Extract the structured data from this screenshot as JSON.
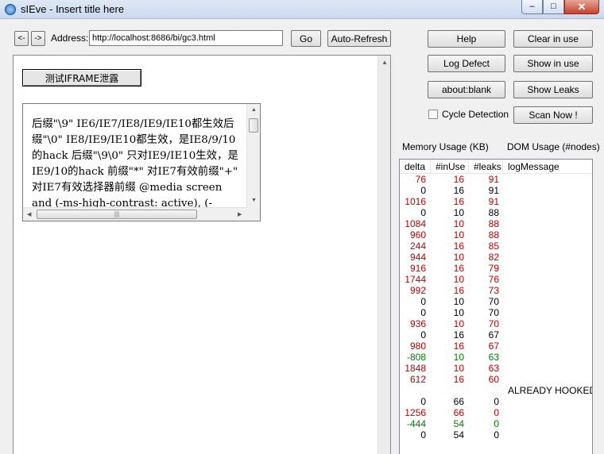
{
  "window": {
    "title": "sIEve - Insert title here",
    "controls": {
      "minimize": "–",
      "maximize": "□",
      "close": "✕"
    }
  },
  "toolbar": {
    "back": "<-",
    "forward": "->",
    "address_label": "Address:",
    "address_value": "http://localhost:8686/bi/gc3.html",
    "go": "Go",
    "auto_refresh": "Auto-Refresh"
  },
  "actions": {
    "help": "Help",
    "clear_in_use": "Clear in use",
    "log_defect": "Log Defect",
    "show_in_use": "Show in use",
    "about_blank": "about:blank",
    "show_leaks": "Show Leaks",
    "cycle_detection": "Cycle Detection",
    "scan_now": "Scan Now !"
  },
  "page": {
    "iframe_button": "测试IFRAME泄露",
    "textarea_text": "后缀\"\\9\" IE6/IE7/IE8/IE9/IE10都生效后缀\"\\0\" IE8/IE9/IE10都生效，是IE8/9/10的hack 后缀\"\\9\\0\" 只对IE9/IE10生效，是IE9/10的hack 前缀\"*\" 对IE7有效前缀\"+\" 对IE7有效选择器前缀 @media screen and (-ms-high-contrast: active), (-"
  },
  "usage": {
    "memory_label": "Memory Usage (KB)",
    "dom_label": "DOM Usage (#nodes)"
  },
  "colors": {
    "increase": "#c00000",
    "decrease": "#008000",
    "neutral": "#000000"
  },
  "table": {
    "columns": [
      "delta",
      "#inUse",
      "#leaks",
      "logMessage"
    ],
    "rows": [
      {
        "delta": "76",
        "inUse": "16",
        "leaks": "91",
        "msg": "",
        "c": [
          "red",
          "red",
          "red"
        ]
      },
      {
        "delta": "0",
        "inUse": "16",
        "leaks": "91",
        "msg": "",
        "c": [
          "black",
          "black",
          "black"
        ]
      },
      {
        "delta": "1016",
        "inUse": "16",
        "leaks": "91",
        "msg": "",
        "c": [
          "red",
          "red",
          "red"
        ]
      },
      {
        "delta": "0",
        "inUse": "10",
        "leaks": "88",
        "msg": "",
        "c": [
          "black",
          "black",
          "black"
        ]
      },
      {
        "delta": "1084",
        "inUse": "10",
        "leaks": "88",
        "msg": "",
        "c": [
          "red",
          "red",
          "red"
        ]
      },
      {
        "delta": "960",
        "inUse": "10",
        "leaks": "88",
        "msg": "",
        "c": [
          "red",
          "red",
          "red"
        ]
      },
      {
        "delta": "244",
        "inUse": "16",
        "leaks": "85",
        "msg": "",
        "c": [
          "red",
          "red",
          "red"
        ]
      },
      {
        "delta": "944",
        "inUse": "10",
        "leaks": "82",
        "msg": "",
        "c": [
          "red",
          "red",
          "red"
        ]
      },
      {
        "delta": "916",
        "inUse": "16",
        "leaks": "79",
        "msg": "",
        "c": [
          "red",
          "red",
          "red"
        ]
      },
      {
        "delta": "1744",
        "inUse": "10",
        "leaks": "76",
        "msg": "",
        "c": [
          "red",
          "red",
          "red"
        ]
      },
      {
        "delta": "992",
        "inUse": "16",
        "leaks": "73",
        "msg": "",
        "c": [
          "red",
          "red",
          "red"
        ]
      },
      {
        "delta": "0",
        "inUse": "10",
        "leaks": "70",
        "msg": "",
        "c": [
          "black",
          "black",
          "black"
        ]
      },
      {
        "delta": "0",
        "inUse": "10",
        "leaks": "70",
        "msg": "",
        "c": [
          "black",
          "black",
          "black"
        ]
      },
      {
        "delta": "936",
        "inUse": "10",
        "leaks": "70",
        "msg": "",
        "c": [
          "red",
          "red",
          "red"
        ]
      },
      {
        "delta": "0",
        "inUse": "16",
        "leaks": "67",
        "msg": "",
        "c": [
          "black",
          "black",
          "black"
        ]
      },
      {
        "delta": "980",
        "inUse": "16",
        "leaks": "67",
        "msg": "",
        "c": [
          "red",
          "red",
          "red"
        ]
      },
      {
        "delta": "-808",
        "inUse": "10",
        "leaks": "63",
        "msg": "",
        "c": [
          "green",
          "green",
          "green"
        ]
      },
      {
        "delta": "1848",
        "inUse": "10",
        "leaks": "63",
        "msg": "",
        "c": [
          "red",
          "red",
          "red"
        ]
      },
      {
        "delta": "612",
        "inUse": "16",
        "leaks": "60",
        "msg": "",
        "c": [
          "red",
          "red",
          "red"
        ]
      },
      {
        "delta": "",
        "inUse": "",
        "leaks": "",
        "msg": "ALREADY HOOKED I",
        "c": [
          "black",
          "black",
          "black"
        ]
      },
      {
        "delta": "0",
        "inUse": "66",
        "leaks": "0",
        "msg": "",
        "c": [
          "black",
          "black",
          "black"
        ]
      },
      {
        "delta": "1256",
        "inUse": "66",
        "leaks": "0",
        "msg": "",
        "c": [
          "red",
          "red",
          "red"
        ]
      },
      {
        "delta": "-444",
        "inUse": "54",
        "leaks": "0",
        "msg": "",
        "c": [
          "green",
          "green",
          "green"
        ]
      },
      {
        "delta": "0",
        "inUse": "54",
        "leaks": "0",
        "msg": "",
        "c": [
          "black",
          "black",
          "black"
        ]
      }
    ]
  }
}
